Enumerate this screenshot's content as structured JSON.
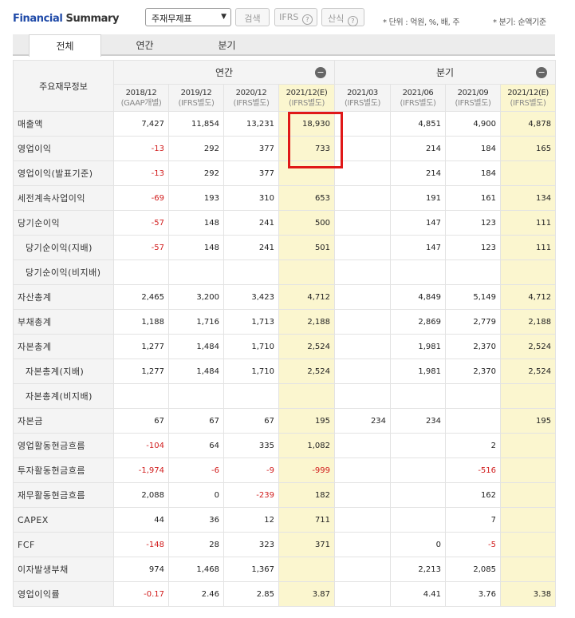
{
  "header": {
    "title_part1": "Financial",
    "title_part2": " Summary",
    "statement_select": "주재무제표",
    "search_button": "검색",
    "ifrs_button": "IFRS",
    "sanshik_button": "산식",
    "help_glyph": "?",
    "unit_note": "* 단위 : 억원, %, 배, 주",
    "basis_note": "* 분기: 순액기준"
  },
  "tabs": [
    "전체",
    "연간",
    "분기"
  ],
  "table": {
    "corner_label": "주요재무정보",
    "group_annual": "연간",
    "group_quarter": "분기",
    "collapse_glyph": "−",
    "periods": [
      {
        "date": "2018/12",
        "sub": "(GAAP개별)"
      },
      {
        "date": "2019/12",
        "sub": "(IFRS별도)"
      },
      {
        "date": "2020/12",
        "sub": "(IFRS별도)"
      },
      {
        "date": "2021/12(E)",
        "sub": "(IFRS별도)"
      },
      {
        "date": "2021/03",
        "sub": "(IFRS별도)"
      },
      {
        "date": "2021/06",
        "sub": "(IFRS별도)"
      },
      {
        "date": "2021/09",
        "sub": "(IFRS별도)"
      },
      {
        "date": "2021/12(E)",
        "sub": "(IFRS별도)"
      }
    ],
    "rows": [
      {
        "label": "매출액",
        "indent": false,
        "values": [
          "7,427",
          "11,854",
          "13,231",
          "18,930",
          "",
          "4,851",
          "4,900",
          "4,878"
        ]
      },
      {
        "label": "영업이익",
        "indent": false,
        "values": [
          "-13",
          "292",
          "377",
          "733",
          "",
          "214",
          "184",
          "165"
        ]
      },
      {
        "label": "영업이익(발표기준)",
        "indent": false,
        "values": [
          "-13",
          "292",
          "377",
          "",
          "",
          "214",
          "184",
          ""
        ]
      },
      {
        "label": "세전계속사업이익",
        "indent": false,
        "values": [
          "-69",
          "193",
          "310",
          "653",
          "",
          "191",
          "161",
          "134"
        ]
      },
      {
        "label": "당기순이익",
        "indent": false,
        "values": [
          "-57",
          "148",
          "241",
          "500",
          "",
          "147",
          "123",
          "111"
        ]
      },
      {
        "label": "당기순이익(지배)",
        "indent": true,
        "values": [
          "-57",
          "148",
          "241",
          "501",
          "",
          "147",
          "123",
          "111"
        ]
      },
      {
        "label": "당기순이익(비지배)",
        "indent": true,
        "values": [
          "",
          "",
          "",
          "",
          "",
          "",
          "",
          ""
        ]
      },
      {
        "label": "자산총계",
        "indent": false,
        "values": [
          "2,465",
          "3,200",
          "3,423",
          "4,712",
          "",
          "4,849",
          "5,149",
          "4,712"
        ]
      },
      {
        "label": "부채총계",
        "indent": false,
        "values": [
          "1,188",
          "1,716",
          "1,713",
          "2,188",
          "",
          "2,869",
          "2,779",
          "2,188"
        ]
      },
      {
        "label": "자본총계",
        "indent": false,
        "values": [
          "1,277",
          "1,484",
          "1,710",
          "2,524",
          "",
          "1,981",
          "2,370",
          "2,524"
        ]
      },
      {
        "label": "자본총계(지배)",
        "indent": true,
        "values": [
          "1,277",
          "1,484",
          "1,710",
          "2,524",
          "",
          "1,981",
          "2,370",
          "2,524"
        ]
      },
      {
        "label": "자본총계(비지배)",
        "indent": true,
        "values": [
          "",
          "",
          "",
          "",
          "",
          "",
          "",
          ""
        ]
      },
      {
        "label": "자본금",
        "indent": false,
        "values": [
          "67",
          "67",
          "67",
          "195",
          "234",
          "234",
          "",
          "195"
        ]
      },
      {
        "label": "영업활동현금흐름",
        "indent": false,
        "values": [
          "-104",
          "64",
          "335",
          "1,082",
          "",
          "",
          "2",
          ""
        ]
      },
      {
        "label": "투자활동현금흐름",
        "indent": false,
        "values": [
          "-1,974",
          "-6",
          "-9",
          "-999",
          "",
          "",
          "-516",
          ""
        ]
      },
      {
        "label": "재무활동현금흐름",
        "indent": false,
        "values": [
          "2,088",
          "0",
          "-239",
          "182",
          "",
          "",
          "162",
          ""
        ]
      },
      {
        "label": "CAPEX",
        "indent": false,
        "values": [
          "44",
          "36",
          "12",
          "711",
          "",
          "",
          "7",
          ""
        ]
      },
      {
        "label": "FCF",
        "indent": false,
        "values": [
          "-148",
          "28",
          "323",
          "371",
          "",
          "0",
          "-5",
          ""
        ]
      },
      {
        "label": "이자발생부채",
        "indent": false,
        "values": [
          "974",
          "1,468",
          "1,367",
          "",
          "",
          "2,213",
          "2,085",
          ""
        ]
      },
      {
        "label": "영업이익률",
        "indent": false,
        "values": [
          "-0.17",
          "2.46",
          "2.85",
          "3.87",
          "",
          "4.41",
          "3.76",
          "3.38"
        ]
      }
    ]
  },
  "colors": {
    "negative": "#d11c1c",
    "estimate_bg": "#fbf6cf",
    "highlight_box": "#e01818",
    "title_blue": "#1f4aa8"
  }
}
